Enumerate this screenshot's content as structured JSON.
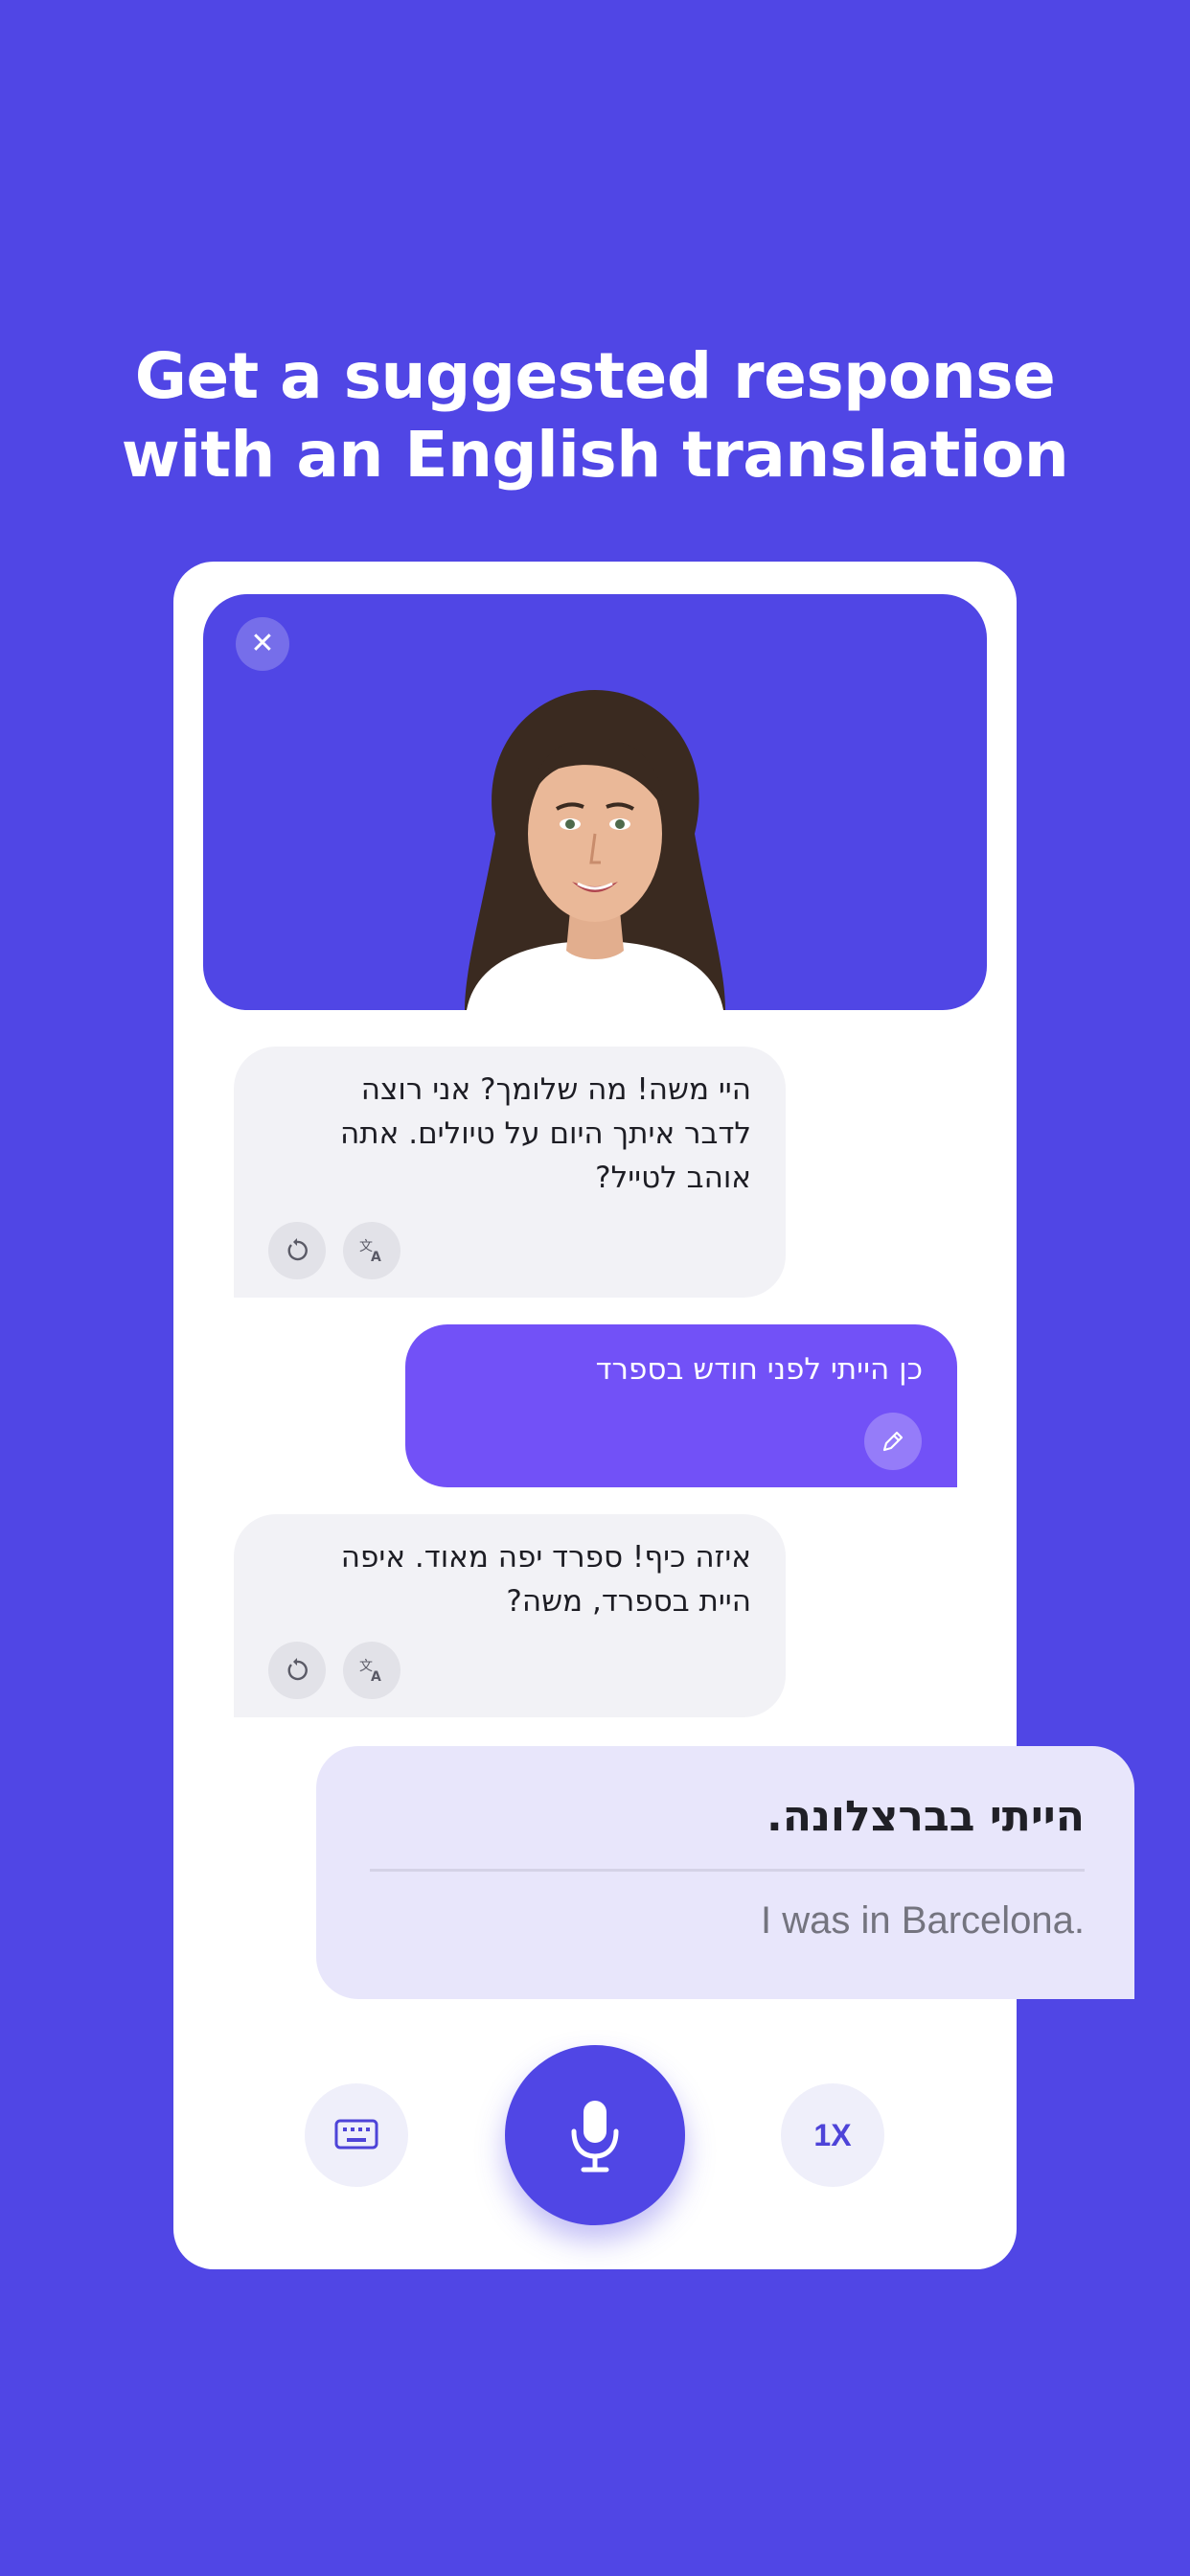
{
  "headline": {
    "line1": "Get a suggested response",
    "line2": "with an English translation"
  },
  "video": {
    "close_glyph": "✕",
    "avatar_icon": "woman-avatar-icon"
  },
  "messages": [
    {
      "role": "assistant",
      "lines": [
        "היי משה! מה שלומך? אני רוצה",
        "לדבר איתך היום על טיולים. אתה",
        "אוהב לטייל?"
      ],
      "actions": [
        "replay-icon",
        "translate-icon"
      ]
    },
    {
      "role": "user",
      "lines": [
        "כן הייתי לפני חודש בספרד"
      ],
      "actions": [
        "pencil-icon"
      ]
    },
    {
      "role": "assistant",
      "lines": [
        "איזה כיף! ספרד יפה מאוד. איפה",
        "היית בספרד, משה?"
      ],
      "actions": [
        "replay-icon",
        "translate-icon"
      ]
    }
  ],
  "suggestion": {
    "hebrew": "הייתי בברצלונה.",
    "english": "I was in Barcelona."
  },
  "controls": {
    "keyboard_icon": "keyboard-icon",
    "mic_icon": "microphone-icon",
    "speed_label": "1X"
  },
  "colors": {
    "background": "#5046e5",
    "card": "#ffffff",
    "ai_bubble": "#f2f2f6",
    "user_bubble": "#7251f7",
    "suggestion_bg": "#e8e6fb",
    "accent": "#4e44d8"
  }
}
